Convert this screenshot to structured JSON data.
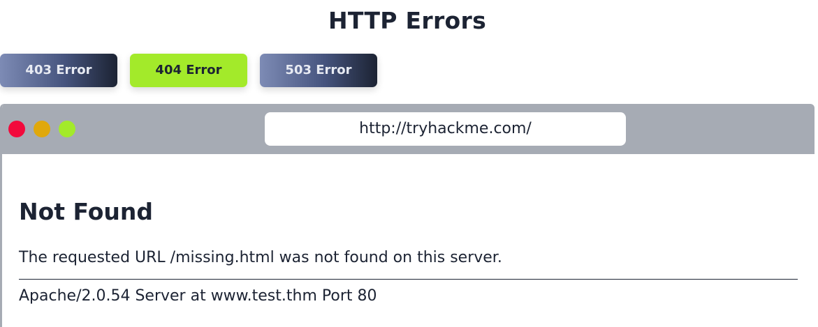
{
  "page": {
    "title": "HTTP Errors"
  },
  "tabs": [
    {
      "label": "403 Error",
      "active": false
    },
    {
      "label": "404 Error",
      "active": true
    },
    {
      "label": "503 Error",
      "active": false
    }
  ],
  "colors": {
    "active_tab": "#a3ea2a",
    "dot_red": "#f20a3c",
    "dot_yellow": "#e0a80c",
    "dot_green": "#a3ea2a",
    "browser_bar": "#a6abb4",
    "text": "#1c2333"
  },
  "browser": {
    "url": "http://tryhackme.com/",
    "window_controls": [
      "close-dot",
      "minimize-dot",
      "maximize-dot"
    ]
  },
  "error_page": {
    "heading": "Not Found",
    "message": "The requested URL /missing.html was not found on this server.",
    "signature": "Apache/2.0.54 Server at www.test.thm Port 80"
  }
}
